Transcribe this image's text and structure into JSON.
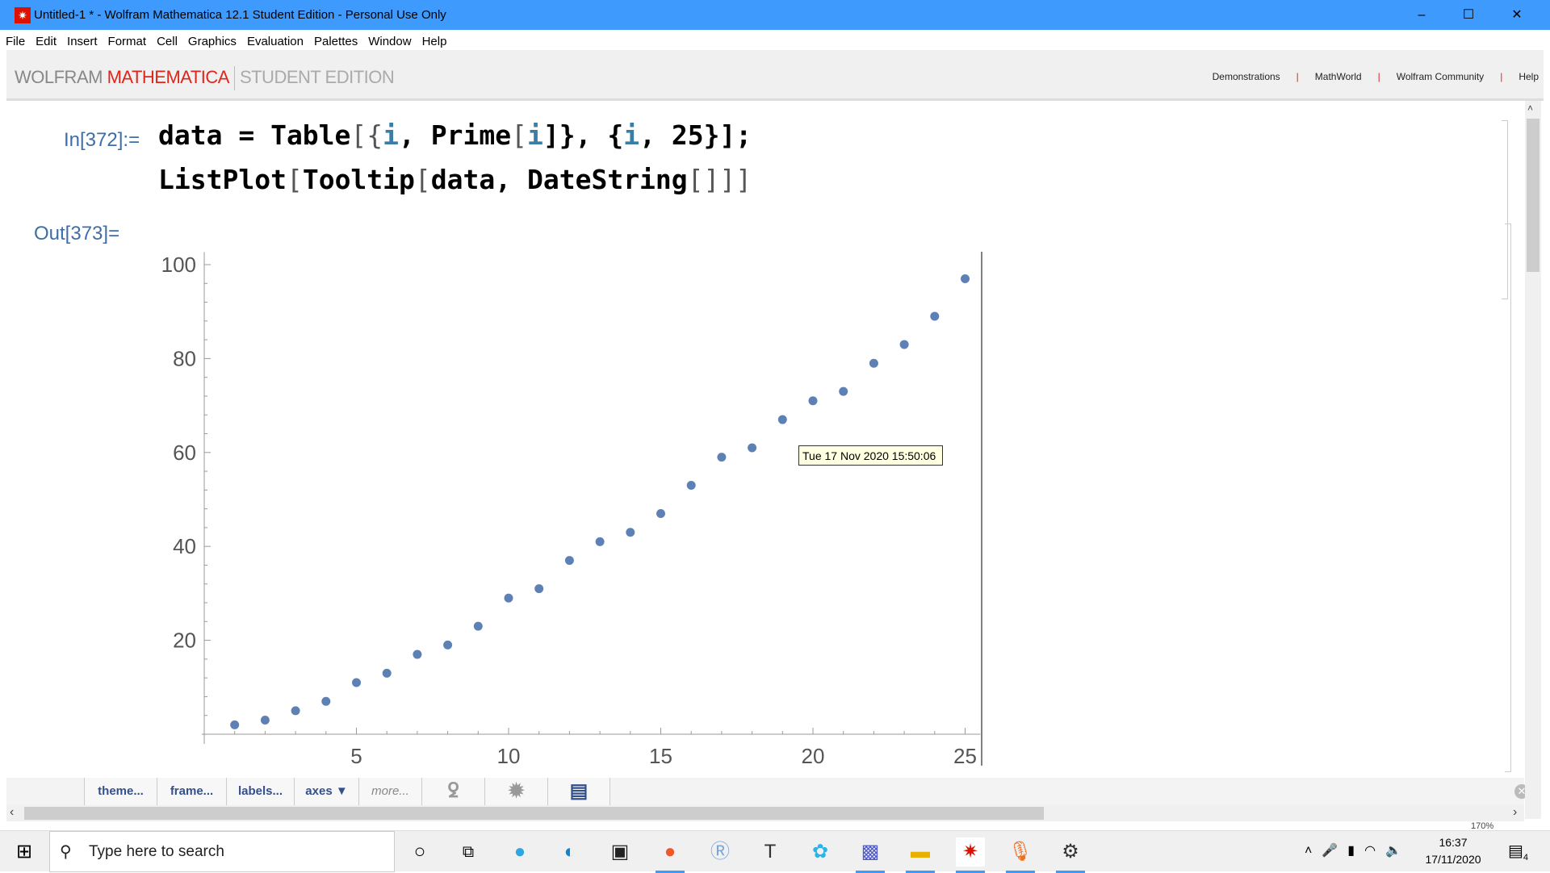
{
  "window": {
    "title": "Untitled-1 * - Wolfram Mathematica 12.1 Student Edition - Personal Use Only",
    "minimize": "–",
    "maximize": "☐",
    "close": "✕"
  },
  "menu": [
    "File",
    "Edit",
    "Insert",
    "Format",
    "Cell",
    "Graphics",
    "Evaluation",
    "Palettes",
    "Window",
    "Help"
  ],
  "banner": {
    "wolfram": "WOLFRAM",
    "mathematica": "MATHEMATICA",
    "edition": "STUDENT EDITION",
    "links": [
      "Demonstrations",
      "MathWorld",
      "Wolfram Community",
      "Help"
    ]
  },
  "cells": {
    "in_label": "In[372]:=",
    "out_label": "Out[373]=",
    "code_line1": {
      "a": "data = Table",
      "b": "[{",
      "c": "i",
      "d": ", Prime",
      "e": "[",
      "f": "i",
      "g": "]}, {",
      "h": "i",
      "k": ", 25}];"
    },
    "code_line2": {
      "a": "ListPlot",
      "b": "[",
      "c": "Tooltip",
      "d": "[",
      "e": "data, DateString",
      "f": "[]]]"
    }
  },
  "tooltip": "Tue 17 Nov 2020 15:50:06",
  "chart_data": {
    "type": "scatter",
    "x": [
      1,
      2,
      3,
      4,
      5,
      6,
      7,
      8,
      9,
      10,
      11,
      12,
      13,
      14,
      15,
      16,
      17,
      18,
      19,
      20,
      21,
      22,
      23,
      24,
      25
    ],
    "y": [
      2,
      3,
      5,
      7,
      11,
      13,
      17,
      19,
      23,
      29,
      31,
      37,
      41,
      43,
      47,
      53,
      59,
      61,
      67,
      71,
      73,
      79,
      83,
      89,
      97
    ],
    "xlim": [
      0,
      25.5
    ],
    "ylim": [
      0,
      102
    ],
    "xticks": [
      "5",
      "10",
      "15",
      "20",
      "25"
    ],
    "yticks": [
      "20",
      "40",
      "60",
      "80",
      "100"
    ],
    "point_color": "#5e81b5",
    "grid": false
  },
  "toolbar": {
    "items": [
      "theme...",
      "frame...",
      "labels...",
      "axes ▼",
      "more..."
    ]
  },
  "zoom": "170%",
  "taskbar": {
    "search_placeholder": "Type here to search",
    "time": "16:37",
    "date": "17/11/2020",
    "notifications": "4"
  }
}
